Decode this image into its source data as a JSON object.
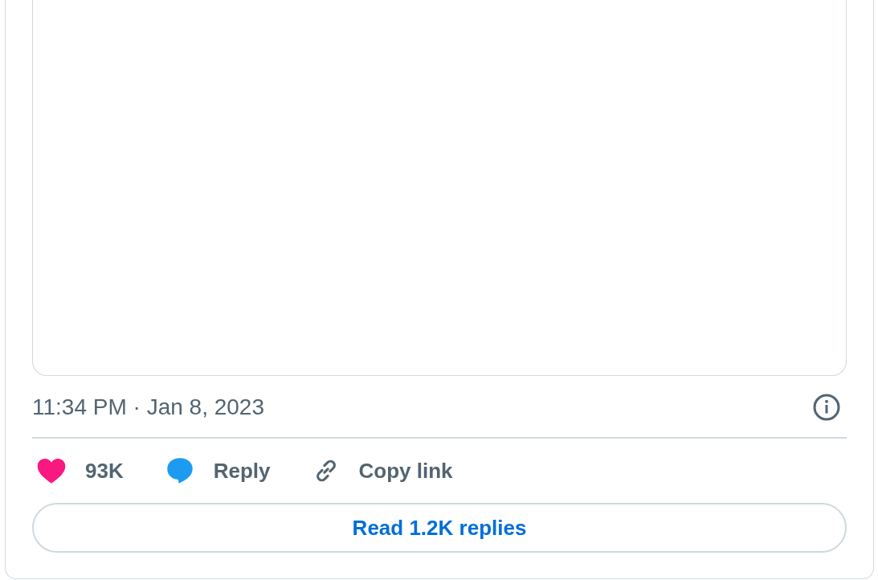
{
  "timestamp": "11:34 PM · Jan 8, 2023",
  "actions": [
    {
      "kind": "like",
      "label": "93K"
    },
    {
      "kind": "reply",
      "label": "Reply"
    },
    {
      "kind": "copy",
      "label": "Copy link"
    }
  ],
  "read_button": "Read 1.2K replies"
}
